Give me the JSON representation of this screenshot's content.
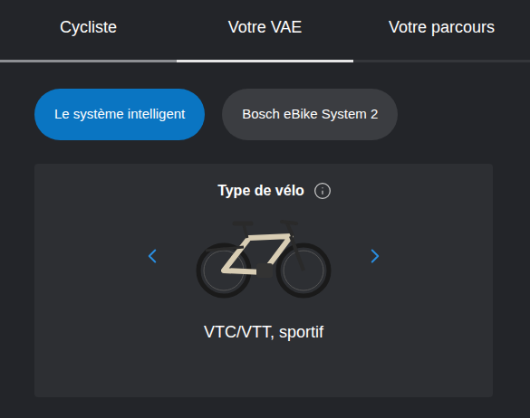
{
  "tabs": [
    {
      "label": "Cycliste",
      "selected": false,
      "completed": true
    },
    {
      "label": "Votre VAE",
      "selected": true,
      "completed": false
    },
    {
      "label": "Votre parcours",
      "selected": false,
      "completed": false
    }
  ],
  "systems": [
    {
      "label": "Le système intelligent",
      "selected": true
    },
    {
      "label": "Bosch eBike System 2",
      "selected": false
    }
  ],
  "bike_type": {
    "title": "Type de vélo",
    "value": "VTC/VTT, sportif"
  }
}
